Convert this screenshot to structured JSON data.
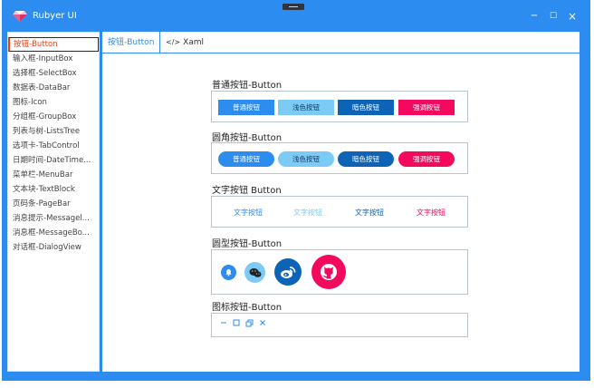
{
  "window": {
    "title": "Rubyer UI",
    "controls": {
      "minimize": "−",
      "maximize": "☐",
      "close": "×"
    }
  },
  "colors": {
    "primary": "#2d8cf0",
    "light": "#7ccbf7",
    "dark": "#0d63b5",
    "danger": "#f5095f",
    "active_text": "#ed4014"
  },
  "sidebar": {
    "items": [
      {
        "label": "按钮-Button",
        "active": true
      },
      {
        "label": "输入框-InputBox"
      },
      {
        "label": "选择框-SelectBox"
      },
      {
        "label": "数据表-DataBar"
      },
      {
        "label": "图标-Icon"
      },
      {
        "label": "分组框-GroupBox"
      },
      {
        "label": "列表与树-ListsTree"
      },
      {
        "label": "选项卡-TabControl"
      },
      {
        "label": "日期时间-DateTime..."
      },
      {
        "label": "菜单栏-MenuBar"
      },
      {
        "label": "文本块-TextBlock"
      },
      {
        "label": "页码条-PageBar"
      },
      {
        "label": "消息提示-Messagel..."
      },
      {
        "label": "消息框-MessageBo..."
      },
      {
        "label": "对话框-DialogView"
      }
    ]
  },
  "tabs": [
    {
      "label": "按钮-Button",
      "icon": "",
      "active": true
    },
    {
      "label": "Xaml",
      "icon": "</>",
      "active": false
    }
  ],
  "sections": {
    "normal": {
      "title": "普通按钮-Button",
      "buttons": [
        "普通按钮",
        "浅色按钮",
        "暗色按钮",
        "强调按钮"
      ]
    },
    "rounded": {
      "title": "圆角按钮-Button",
      "buttons": [
        "普通按钮",
        "浅色按钮",
        "暗色按钮",
        "强调按钮"
      ]
    },
    "text": {
      "title": "文字按钮 Button",
      "buttons": [
        "文字按钮",
        "文字按钮",
        "文字按钮",
        "文字按钮"
      ]
    },
    "circle": {
      "title": "圆型按钮-Button",
      "icons": [
        "bell-icon",
        "wechat-icon",
        "weibo-icon",
        "github-icon"
      ]
    },
    "icon": {
      "title": "图标按钮-Button",
      "icons": [
        "minimize-icon",
        "square-icon",
        "restore-icon",
        "close-icon"
      ]
    }
  }
}
